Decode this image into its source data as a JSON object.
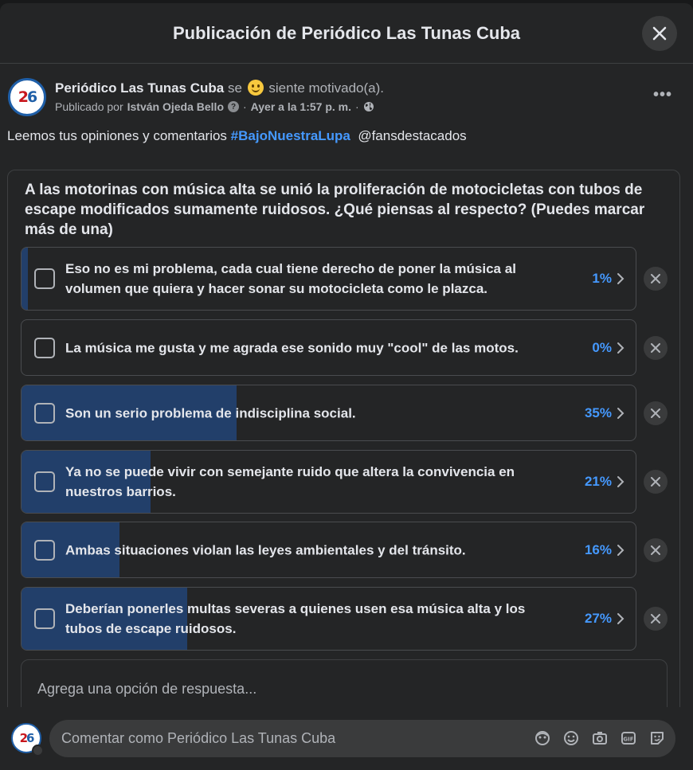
{
  "modal": {
    "title": "Publicación de Periódico Las Tunas Cuba",
    "close_icon": "close-icon"
  },
  "post": {
    "avatar_text": "26",
    "author": "Periódico Las Tunas Cuba",
    "feeling_prefix": "se",
    "feeling_icon": "smiling-face-emoji",
    "feeling_text": "siente motivado(a).",
    "published_by_label": "Publicado por",
    "published_by_name": "István Ojeda Bello",
    "timestamp": "Ayer a la 1:57 p. m.",
    "separator": "·",
    "privacy_icon": "globe-icon",
    "more_icon": "more-options-icon",
    "text_prefix": "Leemos tus opiniones y comentarios",
    "hashtag": "#BajoNuestraLupa",
    "mention": "@fansdestacados"
  },
  "poll": {
    "question": "A las motorinas con música alta se unió la proliferación de motocicletas con tubos de escape modificados sumamente ruidosos. ¿Qué piensas al respecto? (Puedes marcar más de una)",
    "options": [
      {
        "label": "Eso no es mi problema, cada cual tiene derecho de poner la música al volumen que quiera y hacer sonar su motocicleta como le plazca.",
        "percent_label": "1%",
        "percent": 1
      },
      {
        "label": "La música me gusta y me agrada ese sonido muy \"cool\" de las motos.",
        "percent_label": "0%",
        "percent": 0
      },
      {
        "label": "Son un serio problema de indisciplina social.",
        "percent_label": "35%",
        "percent": 35
      },
      {
        "label": "Ya no se puede vivir con semejante ruido que altera la convivencia en nuestros barrios.",
        "percent_label": "21%",
        "percent": 21
      },
      {
        "label": "Ambas situaciones violan las leyes ambientales y del tránsito.",
        "percent_label": "16%",
        "percent": 16
      },
      {
        "label": "Deberían ponerles multas severas a quienes usen esa música alta y los tubos de escape ruidosos.",
        "percent_label": "27%",
        "percent": 27
      }
    ],
    "add_option_placeholder": "Agrega una opción de respuesta..."
  },
  "comment": {
    "placeholder": "Comentar como Periódico Las Tunas Cuba",
    "icons": [
      "avatar-sticker-icon",
      "emoji-icon",
      "camera-icon",
      "gif-icon",
      "sticker-icon"
    ]
  },
  "colors": {
    "background": "#242526",
    "accent": "#4599ff",
    "bar_fill": "#223f6a",
    "text": "#e4e6eb",
    "muted": "#b0b3b8"
  }
}
